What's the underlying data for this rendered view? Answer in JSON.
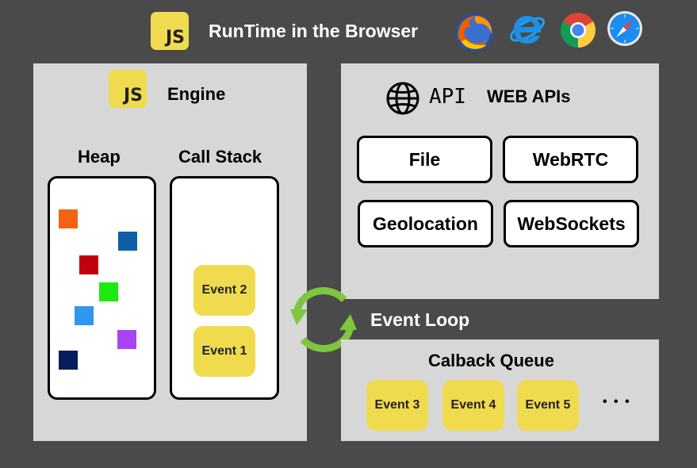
{
  "header": {
    "js_logo": "JS",
    "title": "RunTime in the Browser",
    "browser_icons": [
      "firefox-icon",
      "internet-explorer-icon",
      "chrome-icon",
      "safari-icon"
    ]
  },
  "engine": {
    "js_logo": "JS",
    "title": "Engine",
    "heap_label": "Heap",
    "call_stack_label": "Call Stack",
    "heap_object_colors": [
      "#f26412",
      "#0d5fa6",
      "#c0000b",
      "#1bea0f",
      "#2f97f2",
      "#a745f3",
      "#071d5e"
    ],
    "call_stack": [
      "Event 2",
      "Event 1"
    ]
  },
  "web_apis": {
    "api_text": "API",
    "title": "WEB APIs",
    "items": [
      "File",
      "WebRTC",
      "Geolocation",
      "WebSockets"
    ]
  },
  "event_loop": {
    "label": "Event Loop",
    "icon_color": "#7ec540"
  },
  "callback_queue": {
    "label": "Calback Queue",
    "events": [
      "Event 3",
      "Event 4",
      "Event 5"
    ],
    "ellipsis": "• • •"
  },
  "colors": {
    "background": "#4a4a4a",
    "panel": "#d7d7d7",
    "js_yellow": "#f0db4f"
  }
}
